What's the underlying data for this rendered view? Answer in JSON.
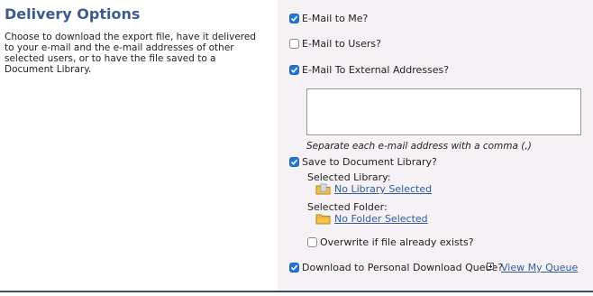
{
  "section": {
    "title": "Delivery Options",
    "description": "Choose to download the export file, have it delivered to your e-mail and the e-mail addresses of other selected users, or to have the file saved to a Document Library."
  },
  "options": {
    "email_me": {
      "label": "E-Mail to Me?",
      "checked": true
    },
    "email_users": {
      "label": "E-Mail to Users?",
      "checked": false
    },
    "email_external": {
      "label": "E-Mail To External Addresses?",
      "checked": true
    },
    "external_addresses": {
      "value": "",
      "hint": "Separate each e-mail address with a comma (,)"
    },
    "save_library": {
      "label": "Save to Document Library?",
      "checked": true
    },
    "selected_library": {
      "label": "Selected Library:",
      "value": "No Library Selected",
      "icon": "library-icon"
    },
    "selected_folder": {
      "label": "Selected Folder:",
      "value": "No Folder Selected",
      "icon": "folder-icon"
    },
    "overwrite": {
      "label": "Overwrite if file already exists?",
      "checked": false
    },
    "download_queue": {
      "label": "Download to Personal Download Queue?",
      "checked": true,
      "link": "View My Queue"
    }
  },
  "colors": {
    "title": "#3d5a8c",
    "panel_background": "#f6f1f5",
    "checkbox_checked": "#1f76d6",
    "link": "#2e5d9e",
    "bottom_rule": "#3b4e6b"
  }
}
